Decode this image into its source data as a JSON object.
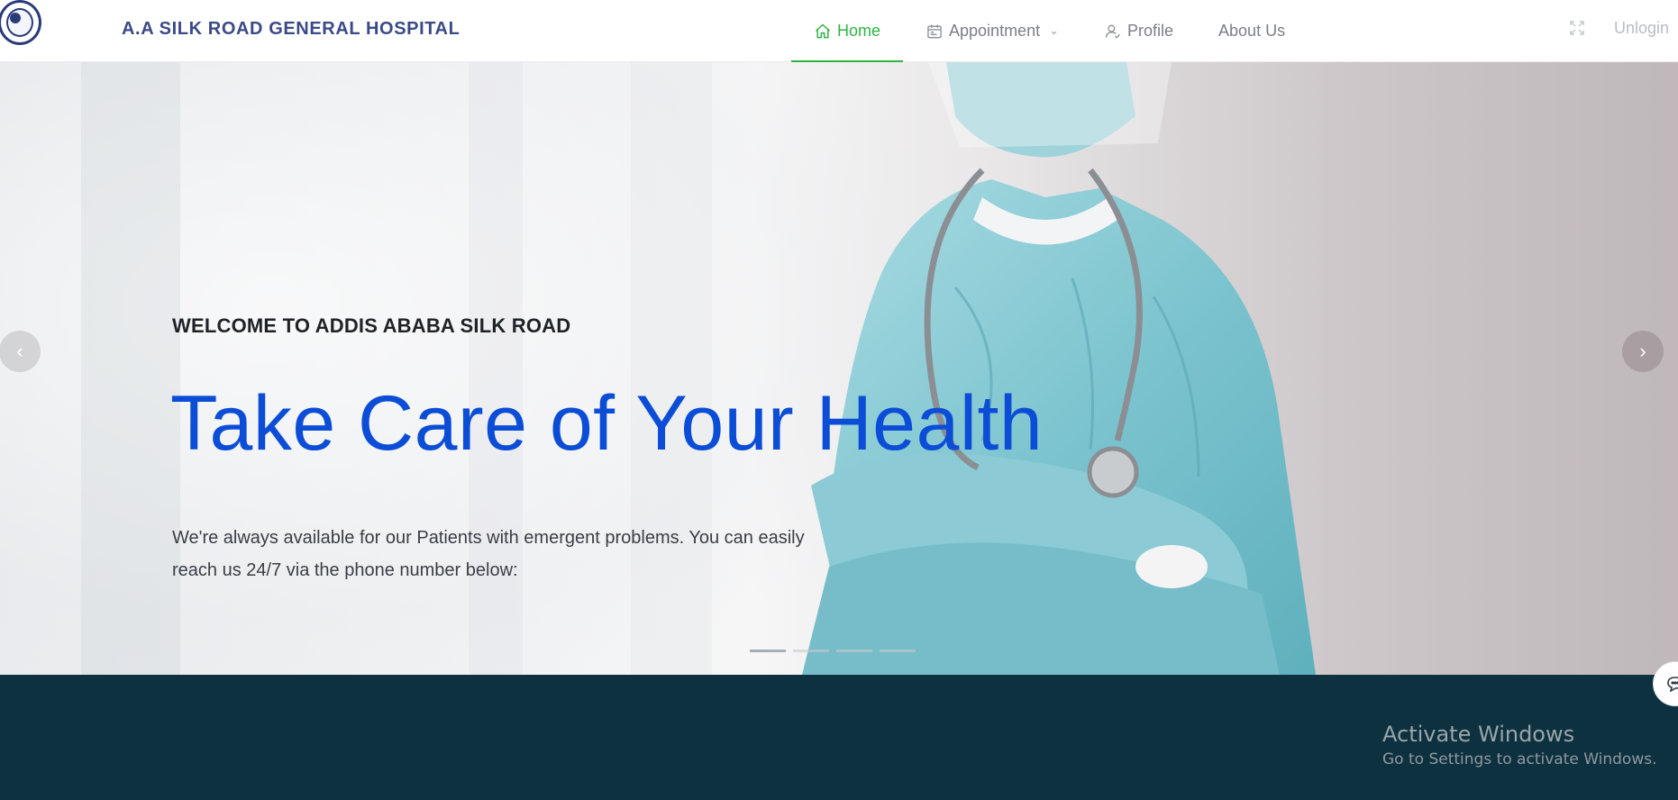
{
  "header": {
    "brand": "A.A SILK ROAD GENERAL HOSPITAL",
    "nav": [
      {
        "label": "Home",
        "icon": "home-icon",
        "active": true
      },
      {
        "label": "Appointment",
        "icon": "calendar-icon",
        "dropdown": true
      },
      {
        "label": "Profile",
        "icon": "user-icon"
      },
      {
        "label": "About Us"
      }
    ],
    "fullscreen_icon": "fullscreen-icon",
    "unlogin": "Unlogin",
    "accent": "#2fb344"
  },
  "hero": {
    "kicker": "WELCOME TO ADDIS ABABA SILK ROAD",
    "headline": "Take Care of Your Health",
    "description": "We're always available for our Patients with emergent problems. You can easily reach us 24/7 via the phone number below:",
    "headline_color": "#0b4dd6",
    "prev_icon": "chevron-left-icon",
    "next_icon": "chevron-right-icon",
    "slides_total": 4,
    "slide_active": 1
  },
  "band": {
    "color": "#0e3140",
    "chat_icon": "chat-icon"
  },
  "watermark": {
    "title": "Activate Windows",
    "subtitle": "Go to Settings to activate Windows."
  }
}
